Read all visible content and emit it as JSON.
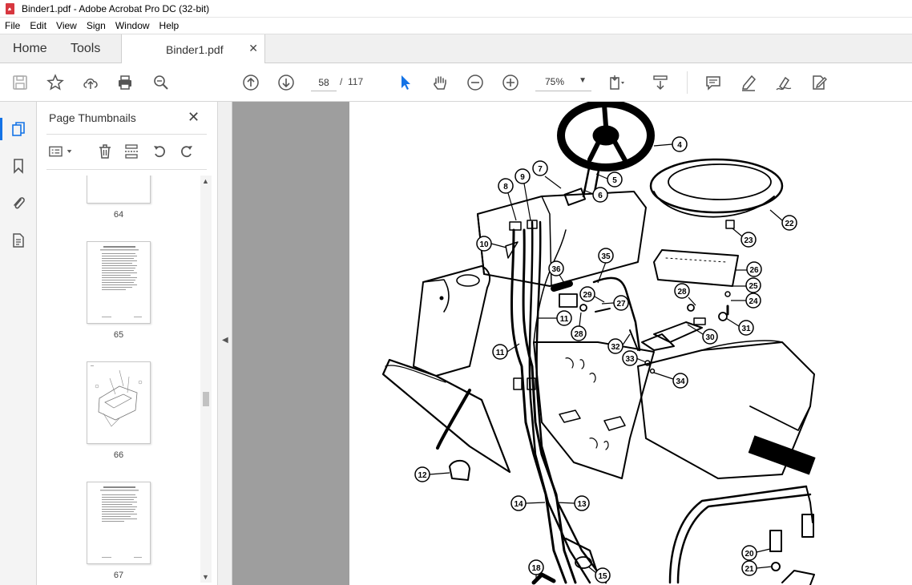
{
  "window": {
    "title": "Binder1.pdf - Adobe Acrobat Pro DC (32-bit)"
  },
  "menu": [
    "File",
    "Edit",
    "View",
    "Sign",
    "Window",
    "Help"
  ],
  "tabs": {
    "home": "Home",
    "tools": "Tools",
    "document": "Binder1.pdf"
  },
  "toolbar": {
    "current_page": "58",
    "page_separator": "/",
    "total_pages": "117",
    "zoom": "75%"
  },
  "panel": {
    "title": "Page Thumbnails",
    "thumbnails": [
      {
        "label": "64"
      },
      {
        "label": "65"
      },
      {
        "label": "66"
      },
      {
        "label": "67"
      }
    ]
  },
  "drawing": {
    "callouts": [
      "4",
      "5",
      "6",
      "7",
      "8",
      "9",
      "10",
      "11",
      "11",
      "12",
      "13",
      "14",
      "15",
      "18",
      "20",
      "21",
      "22",
      "23",
      "24",
      "25",
      "26",
      "27",
      "28",
      "28",
      "29",
      "30",
      "31",
      "32",
      "33",
      "34",
      "35",
      "36"
    ]
  },
  "colors": {
    "accent": "#1473e6",
    "doc_bg": "#9e9e9e",
    "acrobat_red": "#d7373f"
  }
}
